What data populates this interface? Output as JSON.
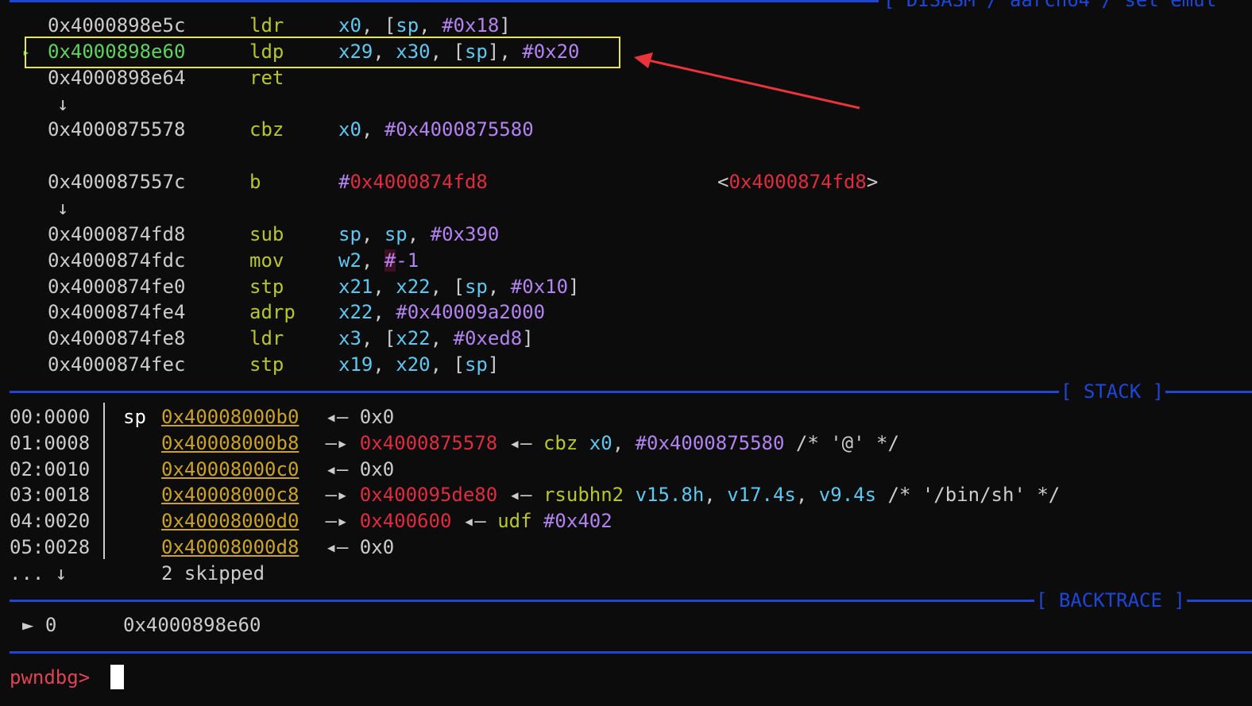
{
  "disasm": {
    "header": "[ DISASM / aarch64 / set emul",
    "rows": [
      {
        "addr": "0x4000898e5c",
        "mnemonic": "ldr",
        "operands": [
          {
            "t": "x0",
            "c": "reg"
          },
          {
            "t": ", [",
            "c": "wht"
          },
          {
            "t": "sp",
            "c": "reg"
          },
          {
            "t": ", ",
            "c": "wht"
          },
          {
            "t": "#0x18",
            "c": "imm"
          },
          {
            "t": "]",
            "c": "wht"
          }
        ]
      },
      {
        "addr": "0x4000898e60",
        "mnemonic": "ldp",
        "current": true,
        "operands": [
          {
            "t": "x29",
            "c": "reg"
          },
          {
            "t": ", ",
            "c": "wht"
          },
          {
            "t": "x30",
            "c": "reg"
          },
          {
            "t": ", [",
            "c": "wht"
          },
          {
            "t": "sp",
            "c": "reg"
          },
          {
            "t": "], ",
            "c": "wht"
          },
          {
            "t": "#0x20",
            "c": "imm"
          }
        ]
      },
      {
        "addr": "0x4000898e64",
        "mnemonic": "ret",
        "operands": []
      },
      {
        "arrow": "↓"
      },
      {
        "addr": "0x4000875578",
        "mnemonic": "cbz",
        "operands": [
          {
            "t": "x0",
            "c": "reg"
          },
          {
            "t": ", ",
            "c": "wht"
          },
          {
            "t": "#0x4000875580",
            "c": "imm"
          }
        ]
      },
      {
        "blank": true
      },
      {
        "addr": "0x400087557c",
        "mnemonic": "b",
        "operands": [
          {
            "t": "#",
            "c": "imm"
          },
          {
            "t": "0x4000874fd8",
            "c": "red"
          }
        ],
        "target": [
          {
            "t": "<",
            "c": "wht"
          },
          {
            "t": "0x4000874fd8",
            "c": "red"
          },
          {
            "t": ">",
            "c": "wht"
          }
        ]
      },
      {
        "arrow": "↓"
      },
      {
        "addr": "0x4000874fd8",
        "mnemonic": "sub",
        "operands": [
          {
            "t": "sp",
            "c": "reg"
          },
          {
            "t": ", ",
            "c": "wht"
          },
          {
            "t": "sp",
            "c": "reg"
          },
          {
            "t": ", ",
            "c": "wht"
          },
          {
            "t": "#0x390",
            "c": "imm"
          }
        ]
      },
      {
        "addr": "0x4000874fdc",
        "mnemonic": "mov",
        "operands": [
          {
            "t": "w2",
            "c": "reg"
          },
          {
            "t": ", ",
            "c": "wht"
          },
          {
            "t": "#",
            "c": "hash-bg"
          },
          {
            "t": "-1",
            "c": "imm"
          }
        ]
      },
      {
        "addr": "0x4000874fe0",
        "mnemonic": "stp",
        "operands": [
          {
            "t": "x21",
            "c": "reg"
          },
          {
            "t": ", ",
            "c": "wht"
          },
          {
            "t": "x22",
            "c": "reg"
          },
          {
            "t": ", [",
            "c": "wht"
          },
          {
            "t": "sp",
            "c": "reg"
          },
          {
            "t": ", ",
            "c": "wht"
          },
          {
            "t": "#0x10",
            "c": "imm"
          },
          {
            "t": "]",
            "c": "wht"
          }
        ]
      },
      {
        "addr": "0x4000874fe4",
        "mnemonic": "adrp",
        "operands": [
          {
            "t": "x22",
            "c": "reg"
          },
          {
            "t": ", ",
            "c": "wht"
          },
          {
            "t": "#0x40009a2000",
            "c": "imm"
          }
        ]
      },
      {
        "addr": "0x4000874fe8",
        "mnemonic": "ldr",
        "operands": [
          {
            "t": "x3",
            "c": "reg"
          },
          {
            "t": ", [",
            "c": "wht"
          },
          {
            "t": "x22",
            "c": "reg"
          },
          {
            "t": ", ",
            "c": "wht"
          },
          {
            "t": "#0xed8",
            "c": "imm"
          },
          {
            "t": "]",
            "c": "wht"
          }
        ]
      },
      {
        "addr": "0x4000874fec",
        "mnemonic": "stp",
        "operands": [
          {
            "t": "x19",
            "c": "reg"
          },
          {
            "t": ", ",
            "c": "wht"
          },
          {
            "t": "x20",
            "c": "reg"
          },
          {
            "t": ", [",
            "c": "wht"
          },
          {
            "t": "sp",
            "c": "reg"
          },
          {
            "t": "]",
            "c": "wht"
          }
        ]
      }
    ],
    "current_marker": "▸"
  },
  "stack": {
    "header": "[ STACK ]",
    "rows": [
      {
        "idx": "00:0000",
        "reg": "sp",
        "addr": "0x40008000b0",
        "rest": [
          {
            "t": " ◂— ",
            "c": "wht"
          },
          {
            "t": "0x0",
            "c": "wht"
          }
        ]
      },
      {
        "idx": "01:0008",
        "reg": "",
        "addr": "0x40008000b8",
        "rest": [
          {
            "t": " —▸ ",
            "c": "wht"
          },
          {
            "t": "0x4000875578",
            "c": "red"
          },
          {
            "t": " ◂— ",
            "c": "wht"
          },
          {
            "t": "cbz ",
            "c": "mn"
          },
          {
            "t": "x0",
            "c": "reg"
          },
          {
            "t": ", ",
            "c": "wht"
          },
          {
            "t": "#0x4000875580",
            "c": "imm"
          },
          {
            "t": " /* '@' */",
            "c": "wht"
          }
        ]
      },
      {
        "idx": "02:0010",
        "reg": "",
        "addr": "0x40008000c0",
        "rest": [
          {
            "t": " ◂— ",
            "c": "wht"
          },
          {
            "t": "0x0",
            "c": "wht"
          }
        ]
      },
      {
        "idx": "03:0018",
        "reg": "",
        "addr": "0x40008000c8",
        "rest": [
          {
            "t": " —▸ ",
            "c": "wht"
          },
          {
            "t": "0x400095de80",
            "c": "red"
          },
          {
            "t": " ◂— ",
            "c": "wht"
          },
          {
            "t": "rsubhn2 ",
            "c": "mn"
          },
          {
            "t": "v15.8h",
            "c": "reg"
          },
          {
            "t": ", ",
            "c": "wht"
          },
          {
            "t": "v17.4s",
            "c": "reg"
          },
          {
            "t": ", ",
            "c": "wht"
          },
          {
            "t": "v9.4s",
            "c": "reg"
          },
          {
            "t": " /* '/bin/sh' */",
            "c": "wht"
          }
        ]
      },
      {
        "idx": "04:0020",
        "reg": "",
        "addr": "0x40008000d0",
        "rest": [
          {
            "t": " —▸ ",
            "c": "wht"
          },
          {
            "t": "0x400600",
            "c": "red"
          },
          {
            "t": " ◂— ",
            "c": "wht"
          },
          {
            "t": "udf ",
            "c": "mn"
          },
          {
            "t": "#0x402",
            "c": "imm"
          }
        ]
      },
      {
        "idx": "05:0028",
        "reg": "",
        "addr": "0x40008000d8",
        "rest": [
          {
            "t": " ◂— ",
            "c": "wht"
          },
          {
            "t": "0x0",
            "c": "wht"
          }
        ]
      }
    ],
    "skipped_prefix": "... ↓",
    "skipped_text": "2 skipped"
  },
  "backtrace": {
    "header": "[ BACKTRACE ]",
    "marker": "► 0",
    "addr": "0x4000898e60"
  },
  "prompt": {
    "text": "pwndbg> "
  },
  "colors": {
    "separator": "#1e46d8",
    "current": "#5fd35f",
    "mnemonic": "#b8c62b",
    "register": "#5fc8f0",
    "immediate": "#b383ef",
    "pointer": "#dd2d3f",
    "stack_addr": "#c9a227",
    "highlight_box": "#e8e83a",
    "annotation_arrow": "#e8343a"
  }
}
